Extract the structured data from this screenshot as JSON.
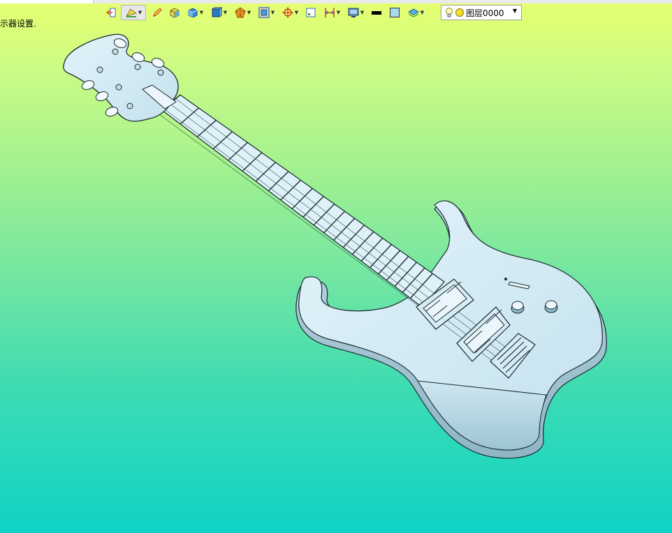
{
  "status_text": "示器设置.",
  "toolbar": {
    "tools": [
      {
        "name": "import-icon",
        "has_dropdown": false
      },
      {
        "name": "render-mode-icon",
        "has_dropdown": true,
        "selected": true
      },
      {
        "name": "pencil-icon",
        "has_dropdown": false
      },
      {
        "name": "box-yellow-icon",
        "has_dropdown": false
      },
      {
        "name": "solid-box-icon",
        "has_dropdown": true
      },
      {
        "name": "view-cube-icon",
        "has_dropdown": true
      },
      {
        "name": "orient-icon",
        "has_dropdown": true
      },
      {
        "name": "zoom-frame-icon",
        "has_dropdown": true
      },
      {
        "name": "snap-target-icon",
        "has_dropdown": true
      },
      {
        "name": "section-icon",
        "has_dropdown": false
      },
      {
        "name": "dimension-icon",
        "has_dropdown": true
      },
      {
        "name": "display-icon",
        "has_dropdown": true
      },
      {
        "name": "line-color-icon",
        "has_dropdown": false
      },
      {
        "name": "fill-color-icon",
        "has_dropdown": false
      },
      {
        "name": "layers-icon",
        "has_dropdown": true
      }
    ],
    "layer_selector": {
      "value": "图层0000"
    }
  },
  "colors": {
    "bg_top": "#e6ff70",
    "bg_bottom": "#0fd3c6",
    "body": "#d4ecf6",
    "fill_swatch": "#a8d8f0"
  }
}
